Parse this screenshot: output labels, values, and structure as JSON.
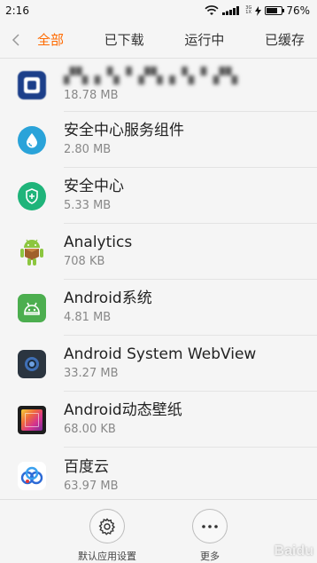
{
  "status_bar": {
    "time": "2:16",
    "network_type_top": "3G",
    "network_type_bottom": "1X",
    "battery_percent": 76,
    "battery_label": "76%"
  },
  "tabs": [
    {
      "label": "全部",
      "active": true
    },
    {
      "label": "已下载",
      "active": false
    },
    {
      "label": "运行中",
      "active": false
    },
    {
      "label": "已缓存",
      "active": false
    }
  ],
  "apps": [
    {
      "name": "▞▚▗▝▖▘▞▚▗▝▖▘▞▚",
      "size": "18.78 MB",
      "icon": "blurred-app-icon"
    },
    {
      "name": "安全中心服务组件",
      "size": "2.80 MB",
      "icon": "water-drop-icon"
    },
    {
      "name": "安全中心",
      "size": "5.33 MB",
      "icon": "shield-plus-icon"
    },
    {
      "name": "Analytics",
      "size": "708 KB",
      "icon": "android-robot-icon"
    },
    {
      "name": "Android系统",
      "size": "4.81 MB",
      "icon": "android-head-icon"
    },
    {
      "name": "Android System WebView",
      "size": "33.27 MB",
      "icon": "webview-icon"
    },
    {
      "name": "Android动态壁纸",
      "size": "68.00 KB",
      "icon": "live-wallpaper-icon"
    },
    {
      "name": "百度云",
      "size": "63.97 MB",
      "icon": "baidu-cloud-icon"
    }
  ],
  "bottom_actions": [
    {
      "label": "默认应用设置",
      "icon": "gear-icon"
    },
    {
      "label": "更多",
      "icon": "more-dots-icon"
    }
  ],
  "watermark": "Baidu",
  "colors": {
    "accent": "#ff6a00",
    "background": "#f5f5f5"
  }
}
